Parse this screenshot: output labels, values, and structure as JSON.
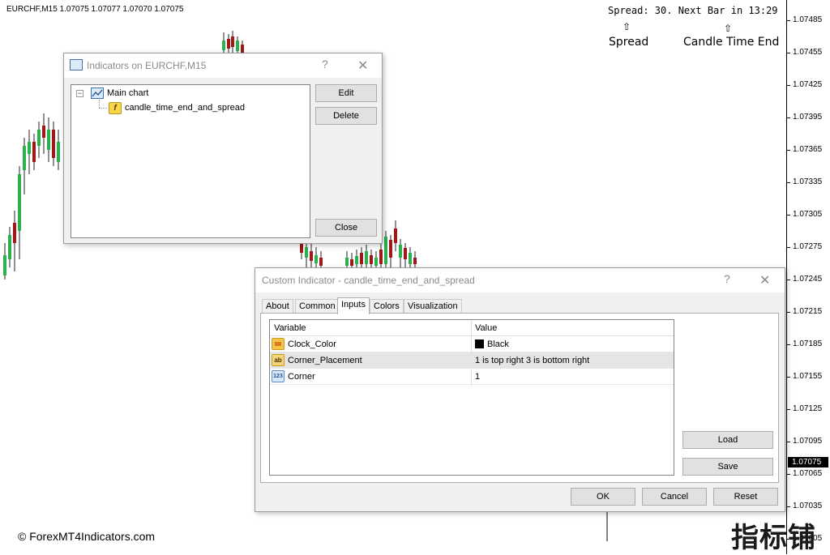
{
  "chart": {
    "symbol_info": "EURCHF,M15  1.07075 1.07077 1.07070 1.07075",
    "spread_text": "Spread: 30. Next Bar in 13:29",
    "annotations": {
      "spread_label": "Spread",
      "candle_label": "Candle Time End",
      "arrow": "⇧"
    },
    "price_ticks": [
      "1.07485",
      "1.07455",
      "1.07425",
      "1.07395",
      "1.07365",
      "1.07335",
      "1.07305",
      "1.07275",
      "1.07245",
      "1.07215",
      "1.07185",
      "1.07155",
      "1.07125",
      "1.07095",
      "1.07065",
      "1.07035",
      "1.07005"
    ],
    "current_price": "1.07075",
    "copyright": "© ForexMT4Indicators.com",
    "watermark": "指标铺",
    "colors": {
      "bull": "#2bb24c",
      "bear": "#a01818",
      "axis": "#000000"
    }
  },
  "indicators_dialog": {
    "title": "Indicators on EURCHF,M15",
    "help": "?",
    "close_glyph": "✕",
    "tree": {
      "root": "Main chart",
      "child": "candle_time_end_and_spread",
      "expander": "−"
    },
    "buttons": {
      "edit": "Edit",
      "delete": "Delete",
      "close": "Close"
    }
  },
  "custom_dialog": {
    "title": "Custom Indicator - candle_time_end_and_spread",
    "help": "?",
    "close_glyph": "✕",
    "tabs": [
      "About",
      "Common",
      "Inputs",
      "Colors",
      "Visualization"
    ],
    "active_tab": "Inputs",
    "table": {
      "headers": [
        "Variable",
        "Value"
      ],
      "rows": [
        {
          "icon": "color-icon",
          "variable": "Clock_Color",
          "value": "Black"
        },
        {
          "icon": "ab-icon",
          "icon_text": "ab",
          "variable": "Corner_Placement",
          "value": "1 is top right 3 is bottom right"
        },
        {
          "icon": "num-icon",
          "icon_text": "123",
          "variable": "Corner",
          "value": "1"
        }
      ]
    },
    "buttons": {
      "load": "Load",
      "save": "Save",
      "ok": "OK",
      "cancel": "Cancel",
      "reset": "Reset"
    }
  }
}
